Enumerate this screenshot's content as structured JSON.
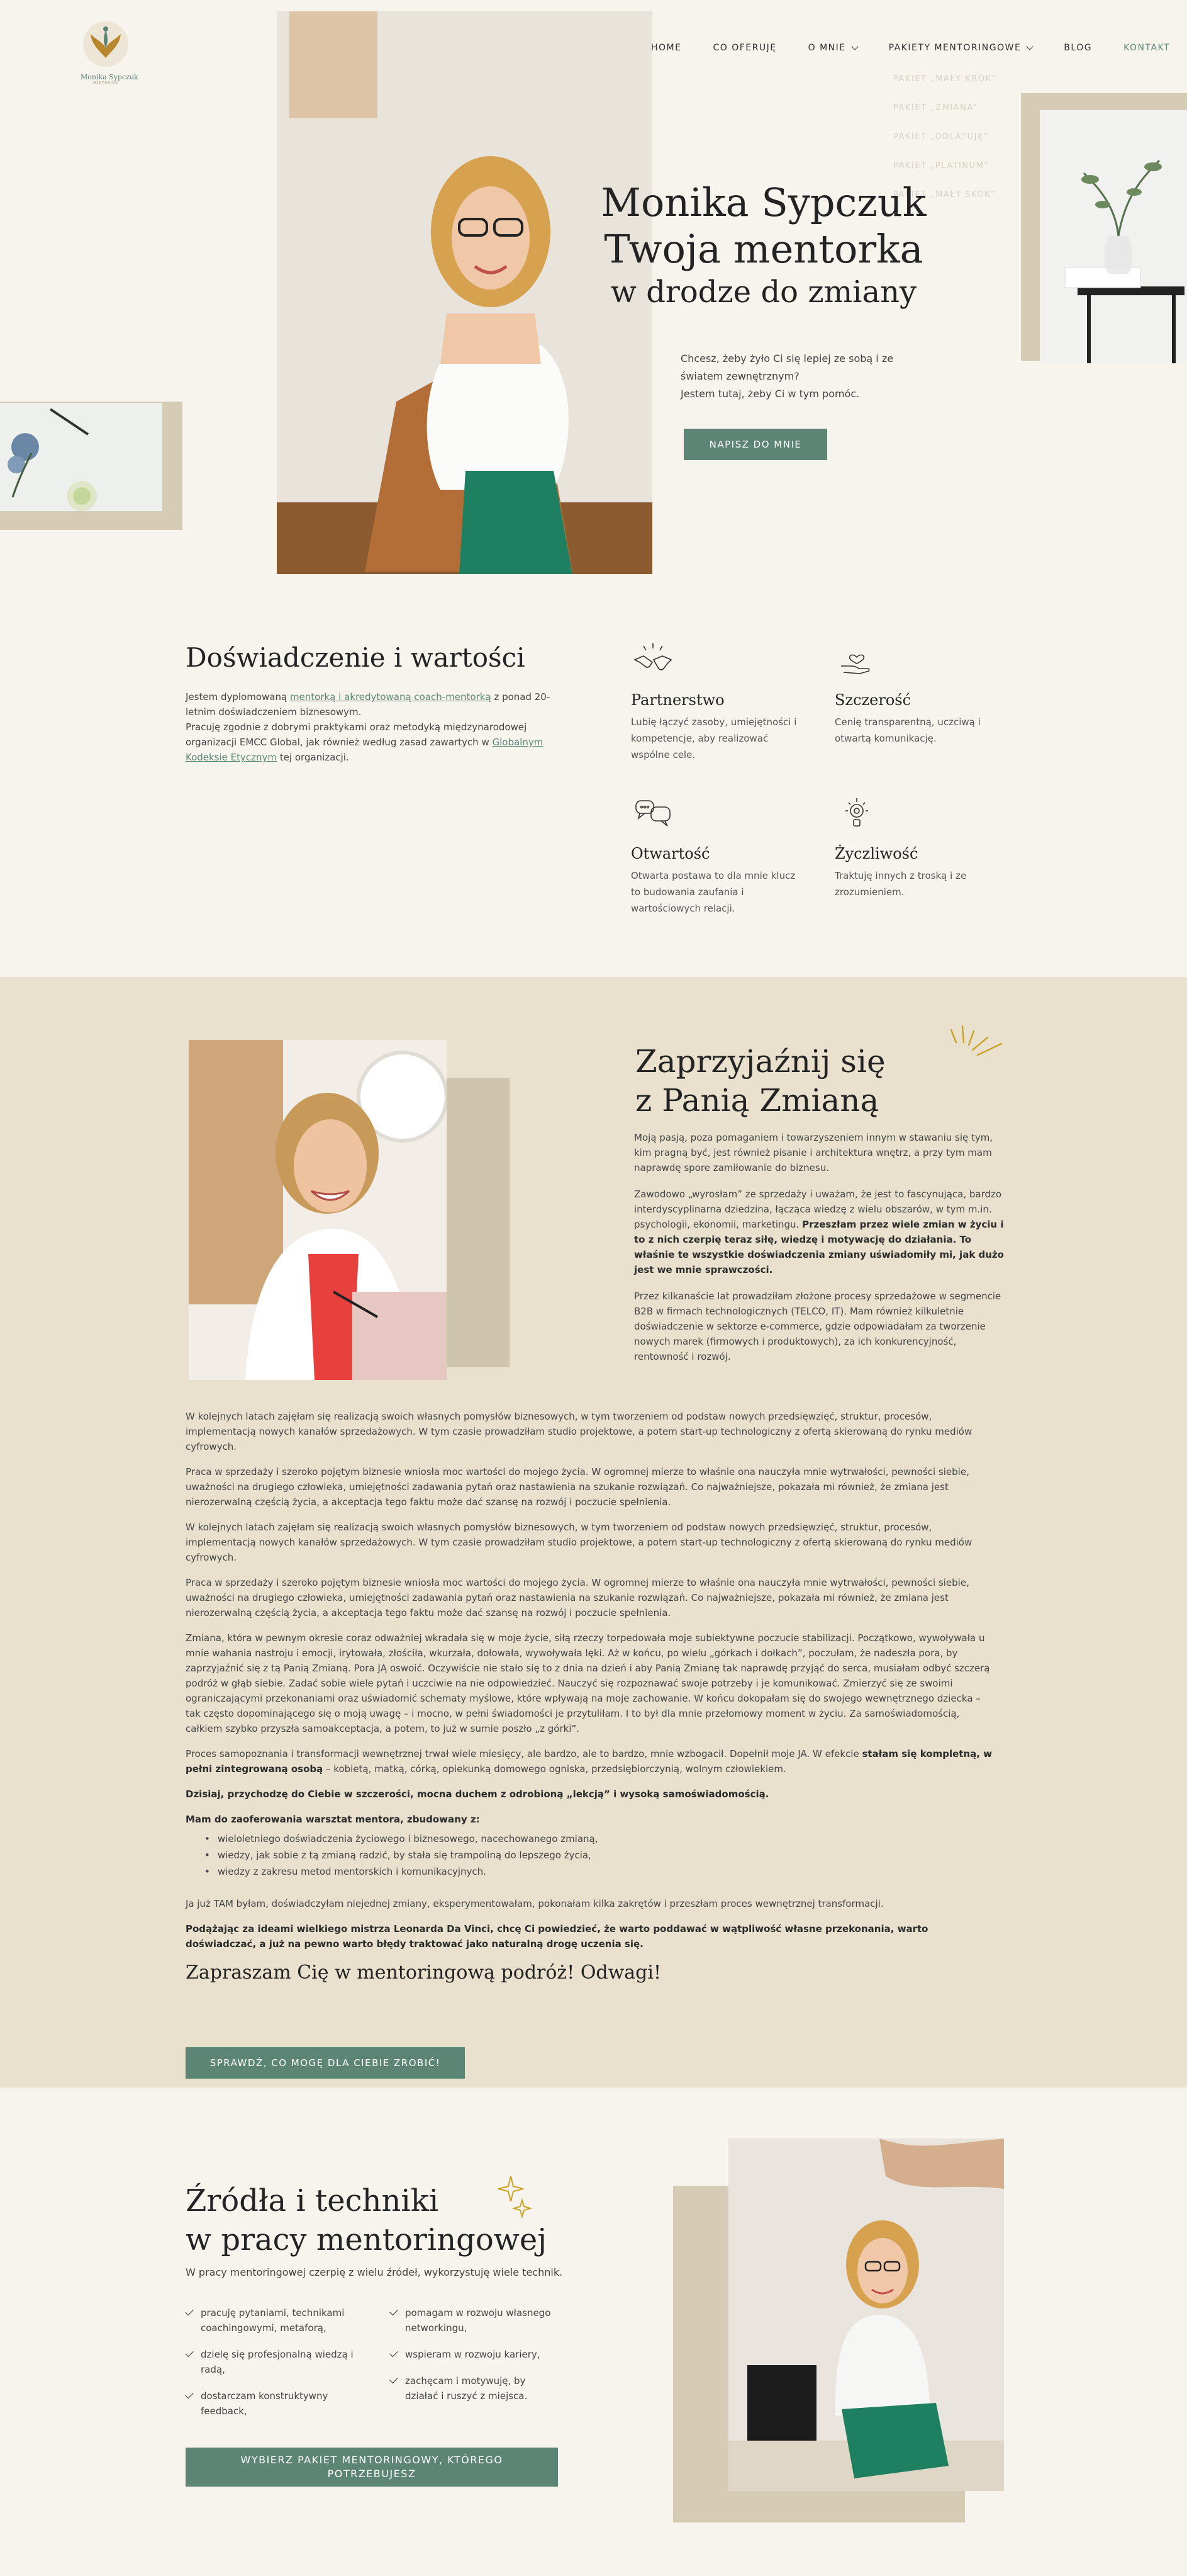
{
  "brand": {
    "logo_name": "Monika Sypczuk",
    "logo_tagline": "MENTORING",
    "accent": "#5c8576",
    "beige": "#d6cbb5",
    "section_bg": "#e9e1cd"
  },
  "nav": {
    "items": [
      {
        "label": "HOME",
        "has_dropdown": false
      },
      {
        "label": "CO OFERUJĘ",
        "has_dropdown": false
      },
      {
        "label": "O MNIE",
        "has_dropdown": true
      },
      {
        "label": "PAKIETY MENTORINGOWE",
        "has_dropdown": true
      },
      {
        "label": "BLOG",
        "has_dropdown": false
      },
      {
        "label": "KONTAKT",
        "has_dropdown": false
      }
    ],
    "active": "KONTAKT",
    "submenu": [
      "PAKIET „MAŁY KROK”",
      "PAKIET „ZMIANA”",
      "PAKIET „ODLATUJĘ”",
      "PAKIET „PLATINUM”",
      "PAKIET „MAŁY SKOK”"
    ]
  },
  "hero": {
    "title_line1": "Monika Sypczuk",
    "title_line2": "Twoja mentorka",
    "title_line3": "w drodze do zmiany",
    "text_line1": "Chcesz, żeby żyło Ci się lepiej ze sobą i ze",
    "text_line2": "światem zewnętrznym?",
    "text_line3": "Jestem tutaj, żeby Ci w tym pomóc.",
    "cta": "NAPISZ DO MNIE"
  },
  "values": {
    "heading": "Doświadczenie i wartości",
    "intro_1": "Jestem dyplomowaną ",
    "intro_link1": "mentorką i akredytowaną coach-mentorką",
    "intro_2": " z ponad 20-letnim doświadczeniem biznesowym.",
    "intro_3": "Pracuję zgodnie z dobrymi praktykami oraz metodyką międzynarodowej organizacji EMCC Global, jak również według zasad zawartych w ",
    "intro_link2": "Globalnym Kodeksie Etycznym",
    "intro_4": " tej organizacji.",
    "cards": [
      {
        "icon": "handshake-icon",
        "title": "Partnerstwo",
        "text": "Lubię łączyć zasoby, umiejętności i kompetencje, aby realizować wspólne cele."
      },
      {
        "icon": "heart-hand-icon",
        "title": "Szczerość",
        "text": "Cenię transparentną, uczciwą i otwartą komunikację."
      },
      {
        "icon": "speech-bubbles-icon",
        "title": "Otwartość",
        "text": "Otwarta postawa to dla mnie klucz to budowania zaufania i wartościowych relacji."
      },
      {
        "icon": "sun-lightbulb-icon",
        "title": "Życzliwość",
        "text": "Traktuję innych z troską i ze zrozumieniem."
      }
    ]
  },
  "story": {
    "heading_line1": "Zaprzyjaźnij się",
    "heading_line2": "z Panią Zmianą",
    "p1": "Moją pasją, poza pomaganiem i towarzyszeniem innym w stawaniu się tym, kim pragną być, jest również pisanie i architektura wnętrz, a przy tym mam naprawdę spore zamiłowanie do biznesu.",
    "p2_a": "Zawodowo „wyrosłam” ze sprzedaży i uważam, że jest to fascynująca, bardzo interdyscyplinarna dziedzina, łącząca wiedzę z wielu obszarów, w tym m.in. psychologii, ekonomii, marketingu. ",
    "p2_b": "Przeszłam przez wiele zmian w życiu i to z nich czerpię teraz siłę, wiedzę i motywację do działania. To właśnie te wszystkie doświadczenia zmiany uświadomiły mi, jak dużo jest we mnie sprawczości.",
    "p3": "Przez kilkanaście lat prowadziłam złożone procesy sprzedażowe w segmencie B2B w firmach technologicznych (TELCO, IT). Mam również kilkuletnie doświadczenie w sektorze e-commerce, gdzie odpowiadałam za tworzenie nowych marek (firmowych i produktowych), za ich konkurencyjność, rentowność i rozwój.",
    "b1": "W kolejnych latach zajęłam się realizacją swoich własnych pomysłów biznesowych, w tym tworzeniem od podstaw nowych przedsięwzięć, struktur, procesów, implementacją nowych kanałów sprzedażowych. W tym czasie prowadziłam studio projektowe, a potem start-up technologiczny z ofertą skierowaną do rynku mediów cyfrowych.",
    "b2": "Praca w sprzedaży i szeroko pojętym biznesie wniosła moc wartości do mojego życia. W ogromnej mierze to właśnie ona nauczyła mnie wytrwałości, pewności siebie, uważności na drugiego człowieka, umiejętności zadawania pytań oraz nastawienia na szukanie rozwiązań. Co najważniejsze, pokazała mi również, że zmiana jest nierozerwalną częścią życia, a akceptacja tego faktu może dać szansę na rozwój i poczucie spełnienia.",
    "b3": "W kolejnych latach zajęłam się realizacją swoich własnych pomysłów biznesowych, w tym tworzeniem od podstaw nowych przedsięwzięć, struktur, procesów, implementacją nowych kanałów sprzedażowych. W tym czasie prowadziłam studio projektowe, a potem start-up technologiczny z ofertą skierowaną do rynku mediów cyfrowych.",
    "b4": "Praca w sprzedaży i szeroko pojętym biznesie wniosła moc wartości do mojego życia. W ogromnej mierze to właśnie ona nauczyła mnie wytrwałości, pewności siebie, uważności na drugiego człowieka, umiejętności zadawania pytań oraz nastawienia na szukanie rozwiązań. Co najważniejsze, pokazała mi również, że zmiana jest nierozerwalną częścią życia, a akceptacja tego faktu może dać szansę na rozwój i poczucie spełnienia.",
    "b5": "Zmiana, która w pewnym okresie coraz odważniej wkradała się w moje życie, siłą rzeczy torpedowała moje subiektywne poczucie stabilizacji. Początkowo, wywoływała u mnie wahania nastroju i emocji, irytowała, złościła, wkurzała, dołowała, wywoływała lęki. Aż w końcu, po wielu „górkach i dołkach”, poczułam, że nadeszła pora, by zaprzyjaźnić się z tą Panią Zmianą. Pora JĄ oswoić. Oczywiście nie stało się to z dnia na dzień i aby Panią Zmianę tak naprawdę przyjąć do serca, musiałam odbyć szczerą podróż w głąb siebie. Zadać sobie wiele pytań i uczciwie na nie odpowiedzieć. Nauczyć się rozpoznawać swoje potrzeby i je komunikować. Zmierzyć się ze swoimi ograniczającymi przekonaniami oraz uświadomić schematy myślowe, które wpływają na moje zachowanie. W końcu dokopałam się do swojego wewnętrznego dziecka – tak często dopominającego się o moją uwagę – i mocno, w pełni świadomości je przytuliłam. I to był dla mnie przełomowy moment w życiu. Za samoświadomością, całkiem szybko przyszła samoakceptacja, a potem, to już w sumie poszło „z górki”.",
    "b6_a": "Proces samopoznania i transformacji wewnętrznej trwał wiele miesięcy, ale bardzo, ale to bardzo, mnie wzbogacił. Dopełnił moje JA. W efekcie ",
    "b6_b": "stałam się kompletną, w pełni zintegrowaną osobą",
    "b6_c": " – kobietą, matką, córką, opiekunką domowego ogniska, przedsiębiorczynią, wolnym człowiekiem.",
    "b7": "Dzisiaj, przychodzę do Ciebie w szczerości, mocna duchem z odrobioną „lekcją” i wysoką samoświadomością.",
    "b8": "Mam do zaoferowania warsztat mentora, zbudowany z:",
    "list": [
      "wieloletniego doświadczenia życiowego i biznesowego, nacechowanego zmianą,",
      "wiedzy, jak sobie z tą zmianą radzić, by stała się trampoliną do lepszego życia,",
      "wiedzy z zakresu metod mentorskich i komunikacyjnych."
    ],
    "b9": "Ja już TAM byłam, doświadczyłam niejednej zmiany, eksperymentowałam, pokonałam kilka zakrętów i przeszłam proces wewnętrznej transformacji.",
    "b10": "Podążając za ideami wielkiego mistrza Leonarda Da Vinci, chcę Ci powiedzieć, że warto poddawać w wątpliwość własne przekonania, warto doświadczać, a już na pewno warto błędy traktować jako naturalną drogę uczenia się.",
    "invite": "Zapraszam Cię w mentoringową podróż! Odwagi!",
    "cta": "SPRAWDŹ, CO MOGĘ DLA CIEBIE ZROBIĆ!"
  },
  "tools": {
    "heading_line1": "Źródła i techniki",
    "heading_line2": "w pracy mentoringowej",
    "lead": "W pracy mentoringowej czerpię z wielu źródeł, wykorzystuję wiele technik.",
    "left": [
      "pracuję pytaniami, technikami coachingowymi, metaforą,",
      "dzielę się profesjonalną wiedzą i radą,",
      "dostarczam konstruktywny feedback,"
    ],
    "right": [
      "pomagam w rozwoju własnego networkingu,",
      "wspieram w rozwoju kariery,",
      "zachęcam i motywuję, by działać i ruszyć z miejsca."
    ],
    "cta": "WYBIERZ PAKIET MENTORINGOWY, KTÓREGO POTRZEBUJESZ"
  }
}
